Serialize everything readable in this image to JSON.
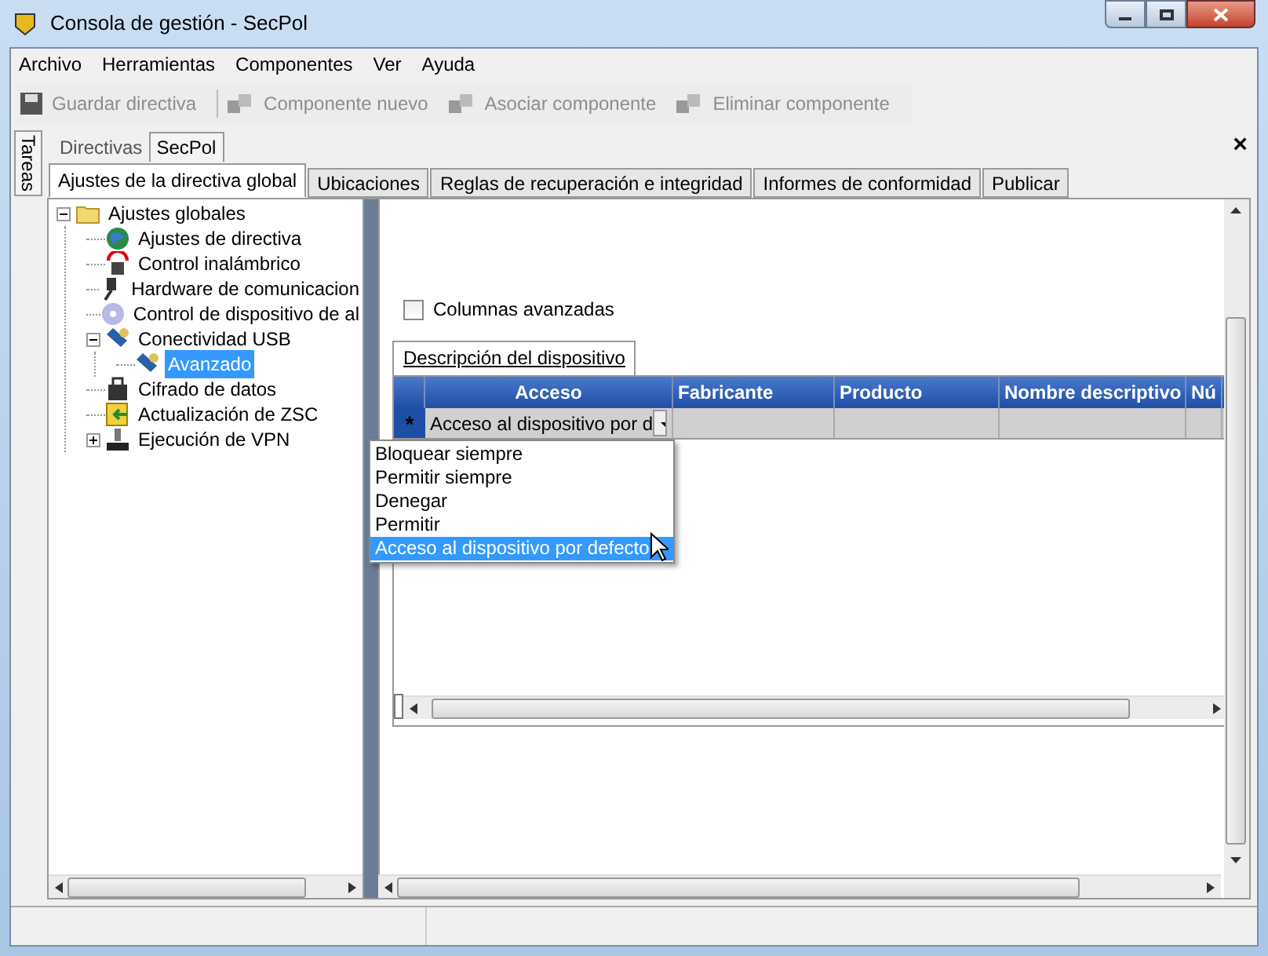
{
  "window": {
    "title": "Consola de gestión - SecPol"
  },
  "menu": [
    "Archivo",
    "Herramientas",
    "Componentes",
    "Ver",
    "Ayuda"
  ],
  "toolbar": [
    {
      "label": "Guardar directiva",
      "disabled": true
    },
    {
      "label": "Componente nuevo",
      "disabled": true
    },
    {
      "label": "Asociar componente",
      "disabled": true
    },
    {
      "label": "Eliminar componente",
      "disabled": true
    }
  ],
  "side_tab": "Tareas",
  "doc_tabs": [
    {
      "label": "Directivas",
      "selected": false
    },
    {
      "label": "SecPol",
      "selected": true
    }
  ],
  "close_glyph": "×",
  "policy_tabs": [
    {
      "label": "Ajustes de la directiva global",
      "selected": true
    },
    {
      "label": "Ubicaciones",
      "selected": false
    },
    {
      "label": "Reglas de recuperación e integridad",
      "selected": false
    },
    {
      "label": "Informes de conformidad",
      "selected": false
    },
    {
      "label": "Publicar",
      "selected": false
    }
  ],
  "tree": [
    {
      "label": "Ajustes globales",
      "expanded": true,
      "selected": false,
      "children": [
        {
          "label": "Ajustes de directiva",
          "selected": false
        },
        {
          "label": "Control inalámbrico",
          "selected": false
        },
        {
          "label": "Hardware de comunicacion",
          "selected": false
        },
        {
          "label": "Control de dispositivo de al",
          "selected": false
        },
        {
          "label": "Conectividad USB",
          "expanded": true,
          "selected": false,
          "children": [
            {
              "label": "Avanzado",
              "selected": true
            }
          ]
        },
        {
          "label": "Cifrado de datos",
          "selected": false
        },
        {
          "label": "Actualización de ZSC",
          "selected": false
        },
        {
          "label": "Ejecución de VPN",
          "expanded": false,
          "selected": false
        }
      ]
    }
  ],
  "advanced_columns": {
    "label": "Columnas avanzadas",
    "checked": false
  },
  "grid_tab": "Descripción del dispositivo",
  "grid": {
    "columns": [
      "Acceso",
      "Fabricante",
      "Producto",
      "Nombre descriptivo",
      "Nú"
    ],
    "new_row_glyph": "*",
    "access_value": "Acceso al dispositivo por d"
  },
  "dropdown": [
    {
      "label": "Bloquear siempre",
      "selected": false
    },
    {
      "label": "Permitir siempre",
      "selected": false
    },
    {
      "label": "Denegar",
      "selected": false
    },
    {
      "label": "Permitir",
      "selected": false
    },
    {
      "label": "Acceso al dispositivo por defecto",
      "selected": true
    }
  ]
}
